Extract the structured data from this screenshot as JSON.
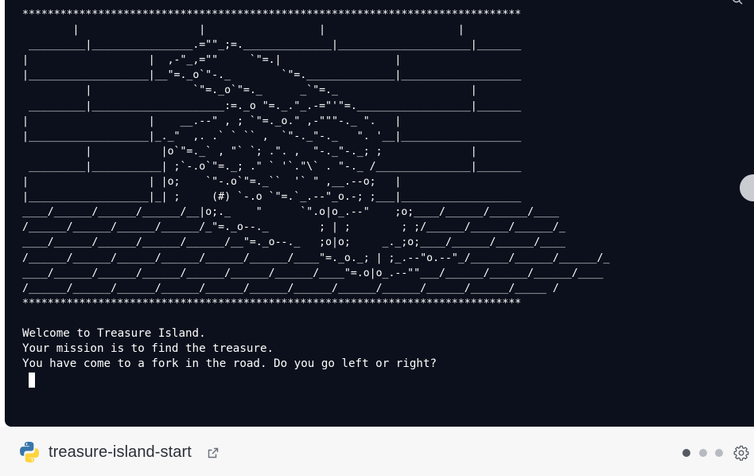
{
  "terminal": {
    "ascii_art": "*******************************************************************************\n        |                   |                  |                     |\n _________|________________.=\"\"_;=.______________|_____________________|_______\n|                   |  ,-\"_,=\"\"     `\"=.|                  |\n|___________________|__\"=._o`\"-._        `\"=.______________|___________________\n          |                `\"=._o`\"=._      _`\"=._                     |\n _________|_____________________:=._o \"=._.\"_.-=\"'\"=.__________________|_______\n|                   |    __.--\" , ; `\"=._o.\" ,-\"\"\"-._ \".   |\n|___________________|_._\"  ,. .` ` `` ,  `\"-._\"-._   \". '__|___________________\n          |           |o`\"=._` , \"` `; .\". ,  \"-._\"-._; ;              |\n _________|___________| ;`-.o`\"=._; .\" ` '`.\"\\` . \"-._ /_______________|_______\n|                   | |o;    `\"-.o`\"=._``  '` \" ,__.--o;   |\n|___________________|_| ;     (#) `-.o `\"=.`_.--\"_o.-; ;___|___________________\n____/______/______/______/__|o;._    \"      `\".o|o_.--\"    ;o;____/______/______/____\n/______/______/______/______/_\"=._o--._        ; | ;        ; ;/______/______/______/_\n____/______/______/______/______/__\"=._o--._   ;o|o;     _._;o;____/______/______/____\n/______/______/______/______/______/______/____\"=._o._; | ;_.--\"o.--\"_/______/______/______/_\n____/______/______/______/______/______/______/____\"=.o|o_.--\"\"___/______/______/______/____\n/______/______/______/______/______/______/______/______/______/______/______/_____ /\n*******************************************************************************",
    "lines": [
      "Welcome to Treasure Island.",
      "Your mission is to find the treasure.",
      "You have come to a fork in the road. Do you go left or right?"
    ]
  },
  "footer": {
    "repl_name": "treasure-island-start",
    "icons": {
      "logo": "python-logo-icon",
      "external": "external-link-icon",
      "settings": "gear-icon"
    },
    "colors": {
      "python_blue": "#3776ab",
      "python_yellow": "#ffd43b",
      "dot_active": "#555a61",
      "dot_inactive": "#b7bbc1"
    }
  }
}
